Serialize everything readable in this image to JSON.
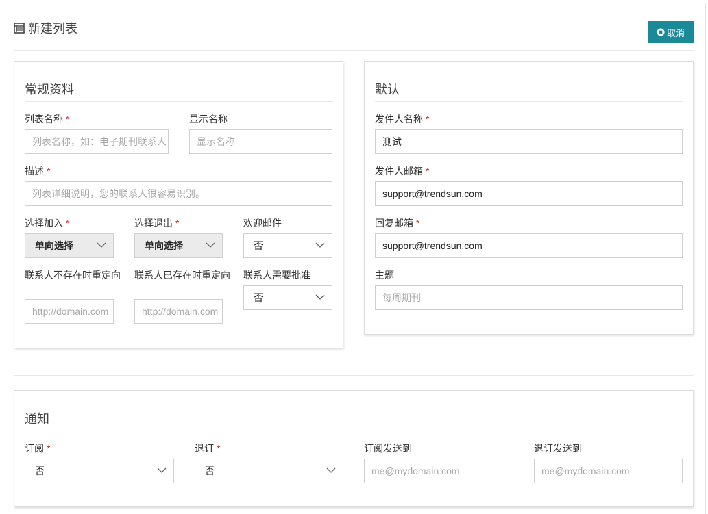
{
  "header": {
    "title": "新建列表",
    "cancel_label": "取消"
  },
  "general": {
    "title": "常规资料",
    "list_name_label": "列表名称",
    "list_name_placeholder": "列表名称，如：电子期刊联系人",
    "display_name_label": "显示名称",
    "display_name_placeholder": "显示名称",
    "description_label": "描述",
    "description_placeholder": "列表详细说明，您的联系人很容易识别。",
    "opt_in_label": "选择加入",
    "opt_in_value": "单向选择",
    "opt_out_label": "选择退出",
    "opt_out_value": "单向选择",
    "welcome_label": "欢迎邮件",
    "welcome_value": "否",
    "redirect_new_label": "联系人不存在时重定向",
    "redirect_new_placeholder": "http://domain.com",
    "redirect_exist_label": "联系人已存在时重定向",
    "redirect_exist_placeholder": "http://domain.com",
    "approval_label": "联系人需要批准",
    "approval_value": "否",
    "required_mark": "*"
  },
  "defaults": {
    "title": "默认",
    "sender_name_label": "发件人名称",
    "sender_name_value": "测试",
    "sender_email_label": "发件人邮箱",
    "sender_email_value": "support@trendsun.com",
    "reply_email_label": "回复邮箱",
    "reply_email_value": "support@trendsun.com",
    "subject_label": "主题",
    "subject_placeholder": "每周期刊"
  },
  "notify": {
    "title": "通知",
    "subscribe_label": "订阅",
    "subscribe_value": "否",
    "unsubscribe_label": "退订",
    "unsubscribe_value": "否",
    "subscribe_to_label": "订阅发送到",
    "subscribe_to_placeholder": "me@mydomain.com",
    "unsubscribe_to_label": "退订发送到",
    "unsubscribe_to_placeholder": "me@mydomain.com"
  },
  "colors": {
    "accent": "#1a8a99",
    "required": "#c9302c",
    "border": "#cfcfcf",
    "placeholder": "#a9a9a9"
  },
  "icons": {
    "title_icon": "list-icon",
    "cancel_icon": "close-circle-icon",
    "select_arrow": "chevron-down-icon"
  }
}
